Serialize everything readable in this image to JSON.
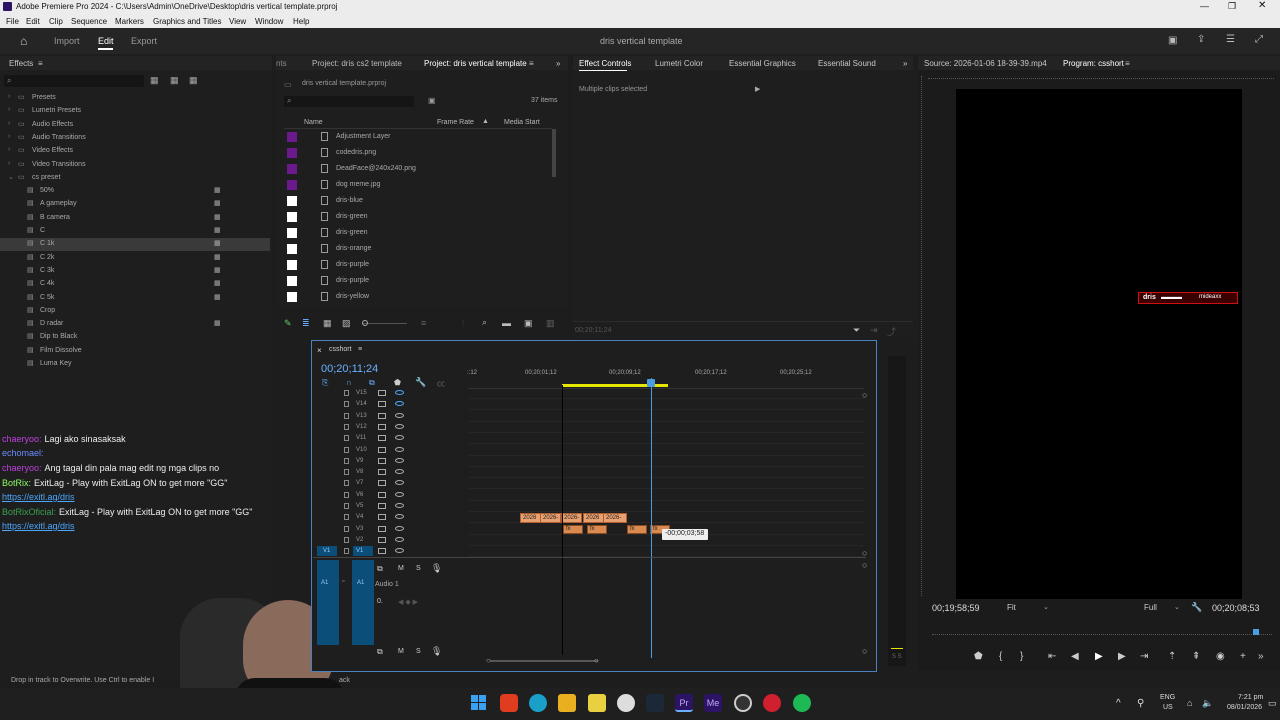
{
  "window": {
    "title": "Adobe Premiere Pro 2024 - C:\\Users\\Admin\\OneDrive\\Desktop\\dris vertical template.prproj"
  },
  "menu": [
    "File",
    "Edit",
    "Clip",
    "Sequence",
    "Markers",
    "Graphics and Titles",
    "View",
    "Window",
    "Help"
  ],
  "workspace": {
    "tabs": [
      "Import",
      "Edit",
      "Export"
    ],
    "active": "Edit",
    "center_title": "dris vertical template"
  },
  "effects": {
    "title": "Effects",
    "folders": [
      "Presets",
      "Lumetri Presets",
      "Audio Effects",
      "Audio Transitions",
      "Video Effects",
      "Video Transitions",
      "cs preset"
    ],
    "presets": [
      "50%",
      "A gameplay",
      "B camera",
      "C",
      "C 1k",
      "C 2k",
      "C 3k",
      "C 4k",
      "C 5k",
      "Crop",
      "D radar",
      "Dip to Black",
      "Film Dissolve",
      "Luma Key"
    ],
    "selected": "C 1k"
  },
  "chat": [
    {
      "user": "chaeryoo:",
      "text": "Lagi ako sinasaksak",
      "color": "#c040e0"
    },
    {
      "user": "echomael:",
      "text": "",
      "color": "#6a8cff"
    },
    {
      "user": "chaeryoo:",
      "text": "Ang tagal din pala mag edit ng mga clips no",
      "color": "#c040e0"
    },
    {
      "user": "BotRix:",
      "text": "ExitLag - Play with ExitLag ON to get more \"GG\"",
      "color": "#8cff60"
    },
    {
      "user": "",
      "text": "https://exitl.ag/dris",
      "color": "#4aa8ff"
    },
    {
      "user": "BotRixOficial:",
      "text": "ExitLag - Play with ExitLag ON to get more \"GG\"",
      "color": "#3aa050"
    },
    {
      "user": "",
      "text": "https://exitl.ag/dris",
      "color": "#4aa8ff"
    }
  ],
  "project": {
    "tab_left": "nts",
    "tab1": "Project: dris cs2 template",
    "tab2": "Project: dris vertical template",
    "file": "dris vertical template.prproj",
    "count": "37 items",
    "col_name": "Name",
    "col_rate": "Frame Rate",
    "col_start": "Media Start",
    "items": [
      {
        "name": "Adjustment Layer",
        "color": "#6a1a8a"
      },
      {
        "name": "codedris.png",
        "color": "#6a1a8a"
      },
      {
        "name": "DeadFace@240x240.png",
        "color": "#6a1a8a"
      },
      {
        "name": "dog meme.jpg",
        "color": "#6a1a8a"
      },
      {
        "name": "dris-blue",
        "color": "#ffffff"
      },
      {
        "name": "dris-green",
        "color": "#ffffff"
      },
      {
        "name": "dris-green",
        "color": "#ffffff"
      },
      {
        "name": "dris-orange",
        "color": "#ffffff"
      },
      {
        "name": "dris-purple",
        "color": "#ffffff"
      },
      {
        "name": "dris-purple",
        "color": "#ffffff"
      },
      {
        "name": "dris-yellow",
        "color": "#ffffff"
      }
    ]
  },
  "effect_controls": {
    "tabs": [
      "Effect Controls",
      "Lumetri Color",
      "Essential Graphics",
      "Essential Sound"
    ],
    "msg": "Multiple clips selected",
    "time": "00;20;11;24"
  },
  "source": {
    "title": "Source: 2026-01-06 18-39-39.mp4",
    "program": "Program: csshort"
  },
  "program": {
    "timecode_left": "00;19;58;59",
    "fit": "Fit",
    "quality": "Full",
    "timecode_right": "00;20;08;53",
    "overlay_left": "dris",
    "overlay_right": "mideaxx"
  },
  "timeline": {
    "seq": "csshort",
    "timecode": "00;20;11;24",
    "ruler": [
      "::12",
      "00;20;01;12",
      "00;20;09;12",
      "00;20;17;12",
      "00;20;25;12"
    ],
    "tracks": [
      "V15",
      "V14",
      "V13",
      "V12",
      "V11",
      "V10",
      "V9",
      "V8",
      "V7",
      "V6",
      "V5",
      "V4",
      "V3",
      "V2",
      "V1"
    ],
    "v1_src": "V1",
    "a1_src": "A1",
    "a1": "A1",
    "audio_label": "Audio 1",
    "m": "M",
    "s": "S",
    "vol": "0.",
    "clips": [
      "2026",
      "2026-",
      "2026-",
      "2026",
      "2026-"
    ],
    "fx": [
      "fx",
      "fx",
      "fx",
      "fx"
    ],
    "tooltip": "-00;00;03;58"
  },
  "status": "Drop in track to Overwrite. Use Ctrl to enable I",
  "status_tail": "ack",
  "tray": {
    "lang1": "ENG",
    "lang2": "US",
    "time": "7:21 pm",
    "date": "08/01/2026"
  }
}
